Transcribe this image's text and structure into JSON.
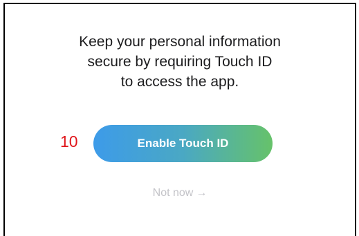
{
  "message": {
    "lines": [
      "Keep your personal information",
      "secure by requiring Touch ID",
      "to access the app."
    ]
  },
  "annotation": {
    "step_number": "10",
    "color": "#e0161b"
  },
  "enable_button": {
    "label": "Enable Touch ID",
    "gradient_start": "#3d9be9",
    "gradient_end": "#66c26a"
  },
  "not_now": {
    "label": "Not now",
    "arrow": "→",
    "icon": "arrow-right-icon"
  }
}
